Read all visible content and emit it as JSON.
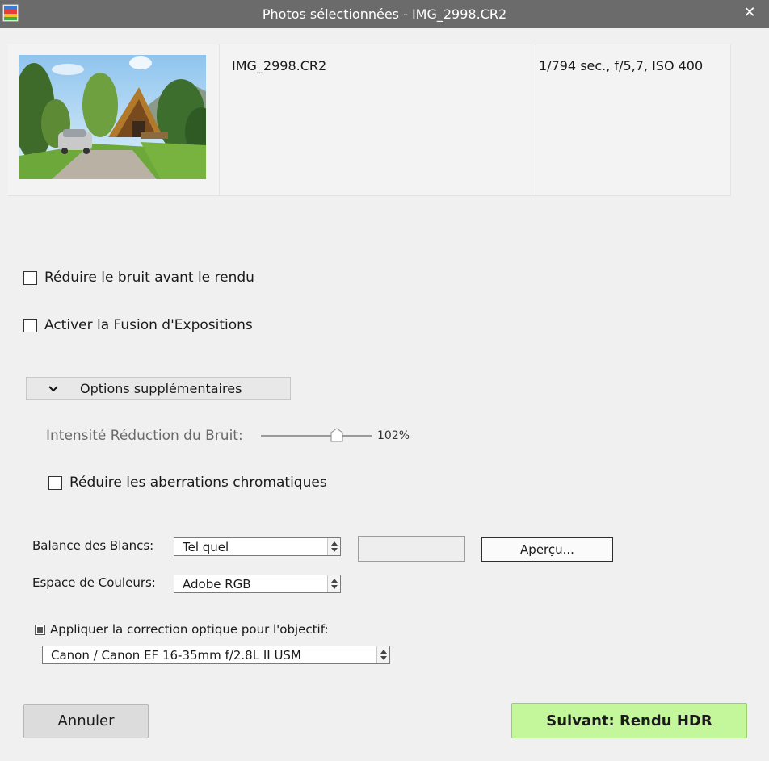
{
  "window": {
    "title": "Photos sélectionnées - IMG_2998.CR2",
    "close_glyph": "✕",
    "icons": {
      "app": "app-icon",
      "close": "close-icon"
    }
  },
  "photo": {
    "filename": "IMG_2998.CR2",
    "exif": "1/794 sec., f/5,7, ISO 400"
  },
  "options": {
    "reduce_noise_before": {
      "label": "Réduire le bruit avant le rendu",
      "checked": false
    },
    "exposure_fusion": {
      "label": "Activer la Fusion d'Expositions",
      "checked": false
    },
    "more_options": {
      "label": "Options supplémentaires",
      "chevron": "chevron-down-icon",
      "expanded": true
    },
    "noise_intensity": {
      "label": "Intensité Réduction du Bruit:",
      "value_text": "102%",
      "slider_fraction": 0.68
    },
    "chromatic_aberration": {
      "label": "Réduire les aberrations chromatiques",
      "checked": false
    }
  },
  "white_balance": {
    "label": "Balance des Blancs:",
    "selected": "Tel quel",
    "preview_button": "Aperçu..."
  },
  "color_space": {
    "label": "Espace de Couleurs:",
    "selected": "Adobe RGB"
  },
  "lens_correction": {
    "label": "Appliquer la correction optique pour l'objectif:",
    "checked": true,
    "selected": "Canon / Canon EF 16-35mm f/2.8L II USM"
  },
  "buttons": {
    "cancel": "Annuler",
    "next": "Suivant: Rendu HDR"
  },
  "colors": {
    "titlebar": "#6b6b6b",
    "next_button": "#c4f69c",
    "background": "#f0f0f0"
  }
}
